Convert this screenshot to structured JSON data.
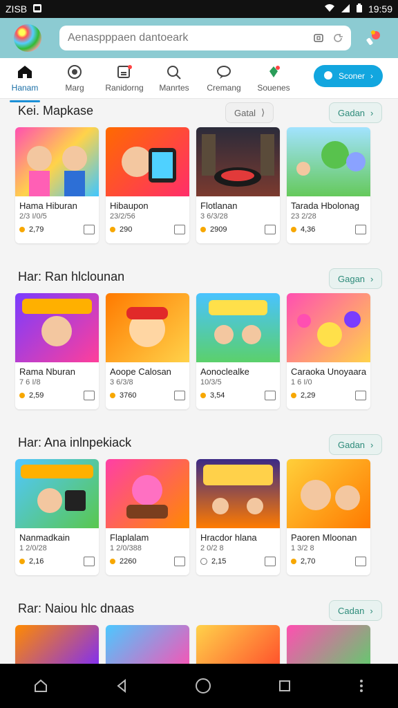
{
  "status": {
    "left_text": "ZISB",
    "time": "19:59"
  },
  "search": {
    "placeholder": "Aenaspppaen dantoeark"
  },
  "tabs": [
    {
      "label": "Hanam",
      "active": true
    },
    {
      "label": "Marg"
    },
    {
      "label": "Ranidorng"
    },
    {
      "label": "Manrtes"
    },
    {
      "label": "Cremang"
    },
    {
      "label": "Souenes"
    }
  ],
  "scene_button": {
    "label": "Sconer"
  },
  "sections": [
    {
      "title": "Kei. Mapkase",
      "pills": [
        "Gatal",
        "Gadan"
      ],
      "items": [
        {
          "title": "Hama Hiburan",
          "sub": "2/3 I/0/5",
          "value": "2,79"
        },
        {
          "title": "Hibaupon",
          "sub": "23/2/56",
          "value": "290"
        },
        {
          "title": "Flotlanan",
          "sub": "3 6/3/28",
          "value": "2909"
        },
        {
          "title": "Tarada Hbolonag",
          "sub": "23 2/28",
          "value": "4,36"
        }
      ]
    },
    {
      "title": "Har: Ran hlclounan",
      "pills": [
        "Gagan"
      ],
      "items": [
        {
          "title": "Rama Nburan",
          "sub": "7 6 I/8",
          "value": "2,59"
        },
        {
          "title": "Aoope Calosan",
          "sub": "3 6/3/8",
          "value": "3760"
        },
        {
          "title": "Aonoclealke",
          "sub": "10/3/5",
          "value": "3,54"
        },
        {
          "title": "Caraoka Unoyaara",
          "sub": "1 6 I/0",
          "value": "2,29"
        }
      ]
    },
    {
      "title": "Har: Ana inlnpekiack",
      "pills": [
        "Gadan"
      ],
      "items": [
        {
          "title": "Nanmadkain",
          "sub": "1 2/0/28",
          "value": "2,16"
        },
        {
          "title": "Flaplalam",
          "sub": "1 2/0/388",
          "value": "2260"
        },
        {
          "title": "Hracdor hlana",
          "sub": "2 0/2 8",
          "value": "2,15"
        },
        {
          "title": "Paoren Mloonan",
          "sub": "1 3/2 8",
          "value": "2,70"
        }
      ]
    },
    {
      "title": "Rar: Naiou hlc dnaas",
      "pills": [
        "Cadan"
      ],
      "items": [
        {
          "title": "",
          "sub": "",
          "value": ""
        },
        {
          "title": "",
          "sub": "",
          "value": ""
        },
        {
          "title": "",
          "sub": "",
          "value": ""
        },
        {
          "title": "",
          "sub": "",
          "value": ""
        }
      ]
    }
  ],
  "icons": {
    "home": "home-icon",
    "game": "gamepad-icon",
    "ranking": "ranking-icon",
    "search": "search-icon",
    "chat": "chat-icon",
    "souvenir": "gift-icon",
    "nav_home": "home-nav-icon",
    "nav_back": "back-triangle-icon",
    "nav_circle": "circle-icon",
    "nav_square": "square-icon",
    "nav_more": "more-dots-icon"
  },
  "colors": {
    "accent": "#12a6df",
    "pill_text": "#2d8b7a",
    "appbar": "#8ccbd2"
  }
}
